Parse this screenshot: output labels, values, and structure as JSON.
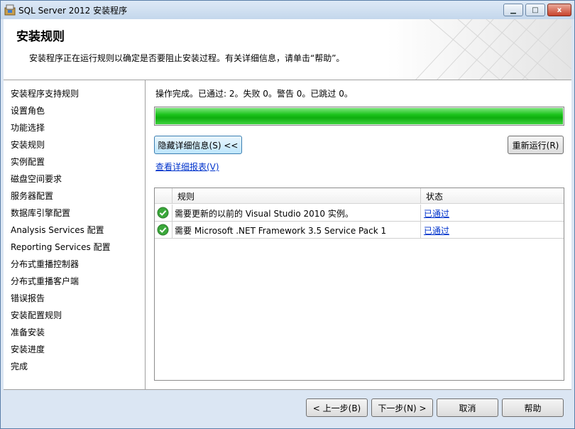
{
  "window": {
    "title": "SQL Server 2012 安装程序",
    "min_label": "▭",
    "max_label": "□",
    "close_label": "x"
  },
  "header": {
    "title": "安装规则",
    "description": "安装程序正在运行规则以确定是否要阻止安装过程。有关详细信息，请单击“帮助”。"
  },
  "sidebar": {
    "items": [
      {
        "label": "安装程序支持规则"
      },
      {
        "label": "设置角色"
      },
      {
        "label": "功能选择"
      },
      {
        "label": "安装规则"
      },
      {
        "label": "实例配置"
      },
      {
        "label": "磁盘空间要求"
      },
      {
        "label": "服务器配置"
      },
      {
        "label": "数据库引擎配置"
      },
      {
        "label": "Analysis Services 配置"
      },
      {
        "label": "Reporting Services 配置"
      },
      {
        "label": "分布式重播控制器"
      },
      {
        "label": "分布式重播客户端"
      },
      {
        "label": "错误报告"
      },
      {
        "label": "安装配置规则"
      },
      {
        "label": "准备安装"
      },
      {
        "label": "安装进度"
      },
      {
        "label": "完成"
      }
    ]
  },
  "main": {
    "status_text": "操作完成。已通过: 2。失败 0。警告 0。已跳过 0。",
    "progress_fraction": 1.0,
    "hide_details_label": "隐藏详细信息(S) <<",
    "rerun_label": "重新运行(R)",
    "view_report_link": "查看详细报表(V)",
    "grid": {
      "col_rule": "规则",
      "col_status": "状态",
      "rows": [
        {
          "rule": "需要更新的以前的 Visual Studio 2010 实例。",
          "status": "已通过"
        },
        {
          "rule": "需要 Microsoft .NET Framework 3.5 Service Pack 1",
          "status": "已通过"
        }
      ]
    }
  },
  "footer": {
    "back_label": "< 上一步(B)",
    "next_label": "下一步(N) >",
    "cancel_label": "取消",
    "help_label": "帮助"
  },
  "colors": {
    "progress_green": "#1dc41d",
    "link_blue": "#0033cc",
    "pass_icon_green": "#3aa83a"
  }
}
